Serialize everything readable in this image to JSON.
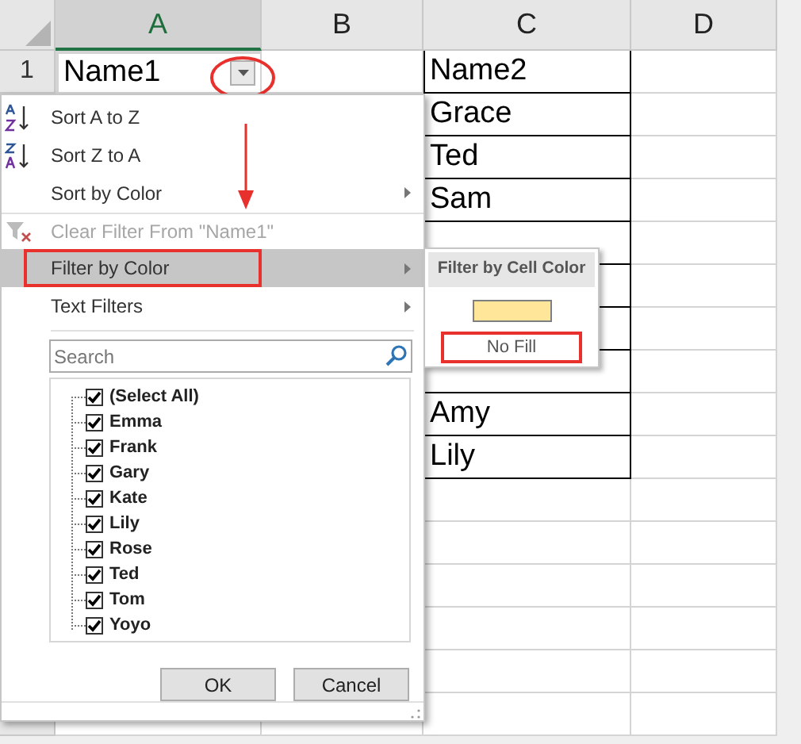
{
  "columns": [
    {
      "label": "A",
      "selected": true
    },
    {
      "label": "B",
      "selected": false
    },
    {
      "label": "C",
      "selected": false
    },
    {
      "label": "D",
      "selected": false
    }
  ],
  "row_number": "1",
  "cell_a1": "Name1",
  "column_c_above_submenu": [
    "Name2",
    "Grace",
    "Ted",
    "Sam"
  ],
  "column_c_below_submenu": [
    "Amy",
    "Lily"
  ],
  "filter_menu": {
    "items": [
      {
        "kind": "sort-ascending",
        "label": "Sort A to Z",
        "disabled": false,
        "selected": false,
        "submenu": false
      },
      {
        "kind": "sort-descending",
        "label": "Sort Z to A",
        "disabled": false,
        "selected": false,
        "submenu": false
      },
      {
        "kind": "plain",
        "label": "Sort by Color",
        "disabled": false,
        "selected": false,
        "submenu": true
      },
      {
        "kind": "clear-filter",
        "label": "Clear Filter From \"Name1\"",
        "disabled": true,
        "selected": false,
        "submenu": false
      },
      {
        "kind": "plain",
        "label": "Filter by Color",
        "disabled": false,
        "selected": true,
        "submenu": true
      },
      {
        "kind": "plain",
        "label": "Text Filters",
        "disabled": false,
        "selected": false,
        "submenu": true
      }
    ],
    "search": {
      "placeholder": "Search"
    },
    "values": [
      {
        "label": "(Select All)",
        "checked": true
      },
      {
        "label": "Emma",
        "checked": true
      },
      {
        "label": "Frank",
        "checked": true
      },
      {
        "label": "Gary",
        "checked": true
      },
      {
        "label": "Kate",
        "checked": true
      },
      {
        "label": "Lily",
        "checked": true
      },
      {
        "label": "Rose",
        "checked": true
      },
      {
        "label": "Ted",
        "checked": true
      },
      {
        "label": "Tom",
        "checked": true
      },
      {
        "label": "Yoyo",
        "checked": true
      }
    ],
    "buttons": [
      "OK",
      "Cancel"
    ]
  },
  "color_submenu": {
    "title": "Filter by Cell Color",
    "swatches": [
      {
        "color": "#ffe699"
      }
    ],
    "option": "No Fill"
  }
}
